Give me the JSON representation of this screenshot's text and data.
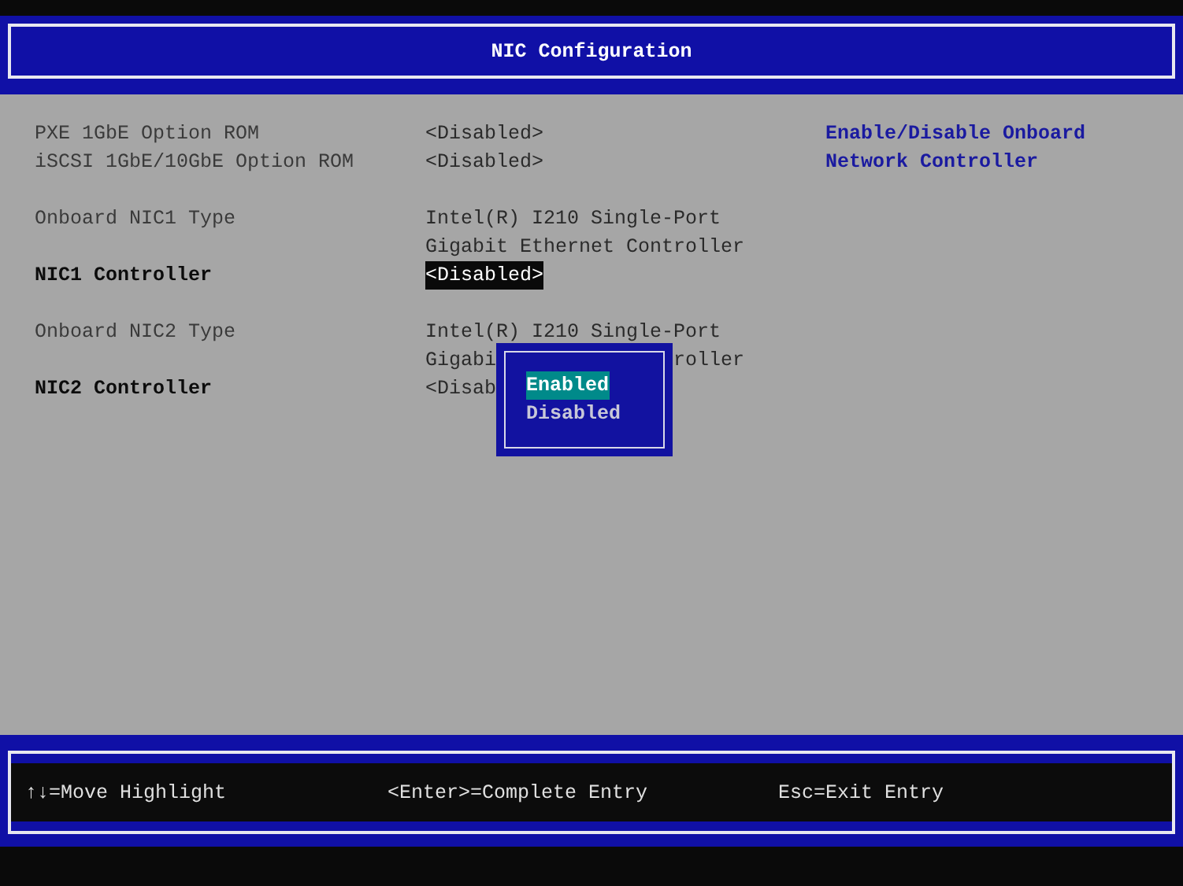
{
  "header": {
    "title": "NIC Configuration"
  },
  "groups": [
    [
      {
        "label": "PXE 1GbE Option ROM",
        "editable": false,
        "selected": false,
        "value_lines": [
          [
            "<Disabled>"
          ]
        ]
      },
      {
        "label": "iSCSI 1GbE/10GbE Option ROM",
        "editable": false,
        "selected": false,
        "value_lines": [
          [
            "<Disabled>"
          ]
        ]
      }
    ],
    [
      {
        "label": "Onboard NIC1 Type",
        "editable": false,
        "selected": false,
        "value_lines": [
          [
            "Intel(R) I210 Single-Port"
          ],
          [
            "Gigabit Ethernet Controller"
          ]
        ]
      },
      {
        "label": "NIC1 Controller",
        "editable": true,
        "selected": true,
        "value_lines": [
          [
            "<Disabled>"
          ]
        ]
      }
    ],
    [
      {
        "label": "Onboard NIC2 Type",
        "editable": false,
        "selected": false,
        "value_lines": [
          [
            "Intel(R) I210 Single-Port"
          ],
          [
            "Gigabi",
            "roller"
          ]
        ]
      },
      {
        "label": "NIC2 Controller",
        "editable": true,
        "selected": false,
        "value_lines": [
          [
            "<Disab"
          ]
        ]
      }
    ]
  ],
  "help": "Enable/Disable Onboard Network Controller",
  "popup": {
    "options": [
      {
        "label": "Enabled",
        "selected": true
      },
      {
        "label": "Disabled",
        "selected": false
      }
    ]
  },
  "footer": [
    "↑↓=Move Highlight",
    "<Enter>=Complete Entry",
    "Esc=Exit Entry"
  ]
}
